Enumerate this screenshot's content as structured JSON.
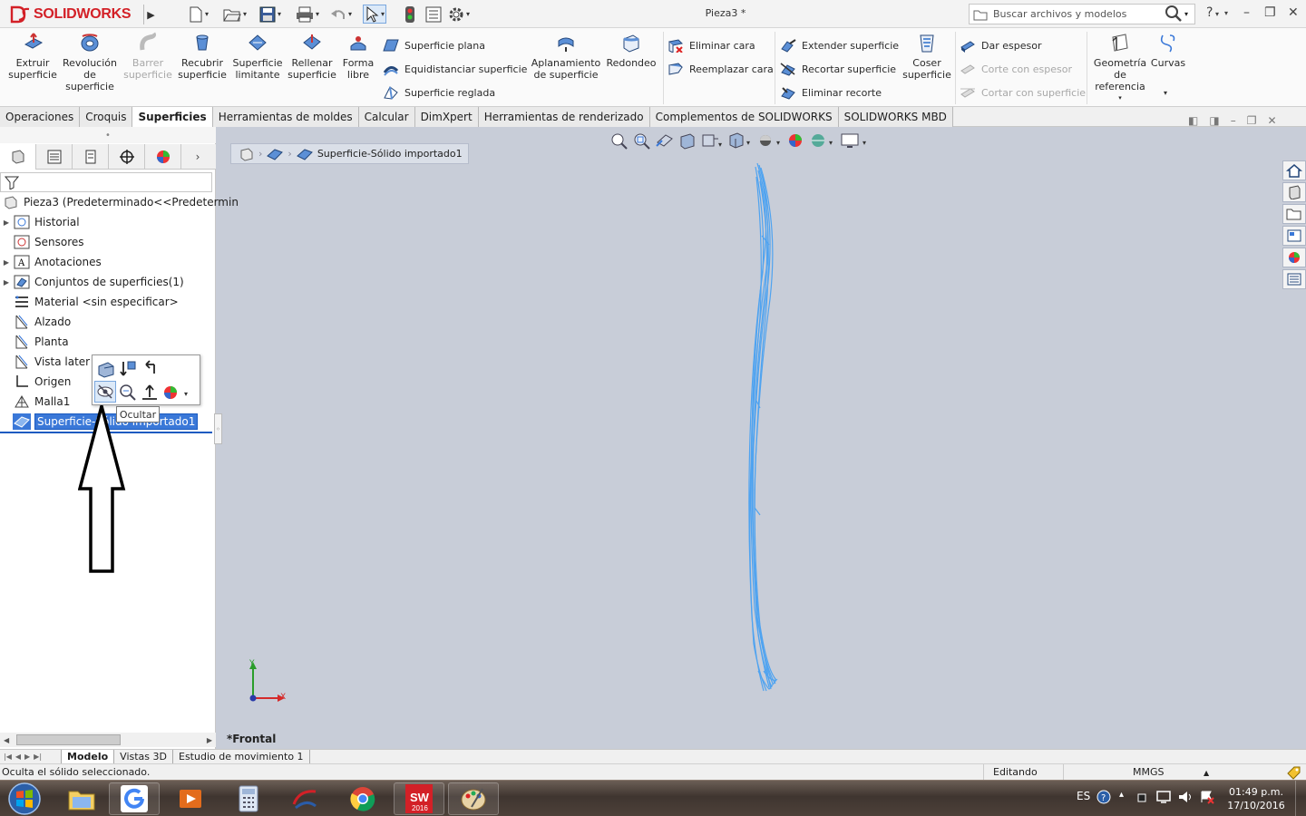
{
  "app": {
    "brand_ds": "3S",
    "brand_name": "SOLIDWORKS",
    "doc_title": "Pieza3 *"
  },
  "search": {
    "placeholder": "Buscar archivos y modelos"
  },
  "title_controls": {
    "help": "?",
    "minimize": "–",
    "restore": "❐",
    "close": "✕"
  },
  "ribbon": {
    "big": [
      {
        "label": "Extruir superficie"
      },
      {
        "label": "Revolución de superficie"
      },
      {
        "label": "Barrer superficie"
      },
      {
        "label": "Recubrir superficie"
      },
      {
        "label": "Superficie limitante"
      },
      {
        "label": "Rellenar superficie"
      },
      {
        "label": "Forma libre"
      },
      {
        "label": "Aplanamiento de superficie"
      },
      {
        "label": "Redondeo"
      },
      {
        "label": "Coser superficie"
      },
      {
        "label": "Geometría de referencia"
      },
      {
        "label": "Curvas"
      }
    ],
    "small": [
      {
        "label": "Superficie plana"
      },
      {
        "label": "Equidistanciar superficie"
      },
      {
        "label": "Superficie reglada"
      },
      {
        "label": "Eliminar cara"
      },
      {
        "label": "Reemplazar cara"
      },
      {
        "label": "Extender superficie"
      },
      {
        "label": "Recortar superficie"
      },
      {
        "label": "Eliminar recorte"
      },
      {
        "label": "Dar espesor"
      },
      {
        "label": "Corte con espesor"
      },
      {
        "label": "Cortar con superficie"
      }
    ]
  },
  "tabs": [
    "Operaciones",
    "Croquis",
    "Superficies",
    "Herramientas de moldes",
    "Calcular",
    "DimXpert",
    "Herramientas de renderizado",
    "Complementos de SOLIDWORKS",
    "SOLIDWORKS MBD"
  ],
  "tree": {
    "root": "Pieza3  (Predeterminado<<Predetermin",
    "items": [
      {
        "label": "Historial"
      },
      {
        "label": "Sensores"
      },
      {
        "label": "Anotaciones"
      },
      {
        "label": "Conjuntos de superficies(1)"
      },
      {
        "label": "Material <sin especificar>"
      },
      {
        "label": "Alzado"
      },
      {
        "label": "Planta"
      },
      {
        "label": "Vista later"
      },
      {
        "label": "Origen"
      },
      {
        "label": "Malla1"
      },
      {
        "label": "Superficie-Sólido importado1"
      }
    ]
  },
  "context_toolbar": {
    "tooltip": "Ocultar"
  },
  "breadcrumb": {
    "label": "Superficie-Sólido importado1"
  },
  "triad": {
    "x": "X",
    "y": "Y"
  },
  "view_name": "*Frontal",
  "bottom_tabs": [
    "Modelo",
    "Vistas 3D",
    "Estudio de movimiento 1"
  ],
  "status": {
    "message": "Oculta el sólido seleccionado.",
    "mode": "Editando Pieza",
    "units": "MMGS"
  },
  "taskbar": {
    "lang": "ES",
    "time": "01:49 p.m.",
    "date": "17/10/2016",
    "sw_badge": "2016"
  },
  "colors": {
    "accent": "#d32027",
    "model_edges": "#4fa3f0",
    "selection": "#3a78d8",
    "viewport": "#c8cdd8"
  }
}
